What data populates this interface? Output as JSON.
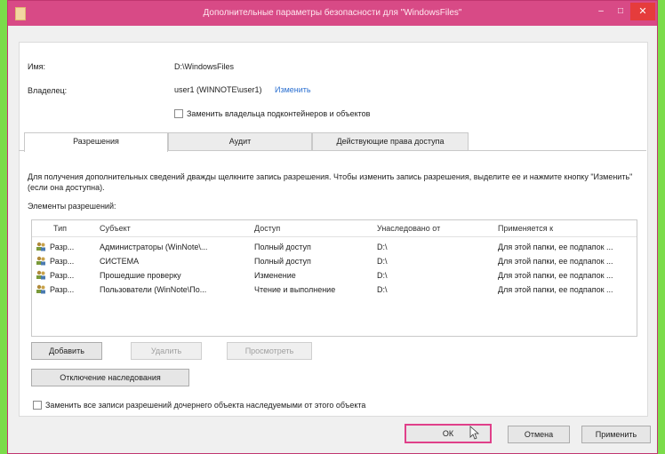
{
  "window": {
    "title": "Дополнительные параметры безопасности  для \"WindowsFiles\"",
    "min": "–",
    "max": "□",
    "close": "✕"
  },
  "info": {
    "name_label": "Имя:",
    "name_value": "D:\\WindowsFiles",
    "owner_label": "Владелец:",
    "owner_value": "user1 (WINNOTE\\user1)",
    "owner_change": "Изменить",
    "replace_owner": "Заменить владельца подконтейнеров и объектов"
  },
  "tabs": [
    "Разрешения",
    "Аудит",
    "Действующие права доступа"
  ],
  "description": "Для получения дополнительных сведений дважды щелкните запись разрешения. Чтобы изменить запись разрешения, выделите ее и нажмите кнопку \"Изменить\" (если она доступна).",
  "elements_label": "Элементы разрешений:",
  "table": {
    "columns": [
      "Тип",
      "Субъект",
      "Доступ",
      "Унаследовано от",
      "Применяется к"
    ],
    "rows": [
      [
        "Разр...",
        "Администраторы (WinNote\\...",
        "Полный доступ",
        "D:\\",
        "Для этой папки, ее подпапок ..."
      ],
      [
        "Разр...",
        "СИСТЕМА",
        "Полный доступ",
        "D:\\",
        "Для этой папки, ее подпапок ..."
      ],
      [
        "Разр...",
        "Прошедшие проверку",
        "Изменение",
        "D:\\",
        "Для этой папки, ее подпапок ..."
      ],
      [
        "Разр...",
        "Пользователи (WinNote\\По...",
        "Чтение и выполнение",
        "D:\\",
        "Для этой папки, ее подпапок ..."
      ]
    ]
  },
  "buttons": {
    "add": "Добавить",
    "remove": "Удалить",
    "view": "Просмотреть",
    "disable_inheritance": "Отключение наследования",
    "ok": "ОК",
    "cancel": "Отмена",
    "apply": "Применить"
  },
  "replace_child": "Заменить все записи разрешений дочернего объекта наследуемыми от этого объекта",
  "colors": {
    "titlebar": "#d84a86",
    "close": "#e53c3c",
    "link": "#2a6fd0",
    "background": "#7bdc4a"
  }
}
